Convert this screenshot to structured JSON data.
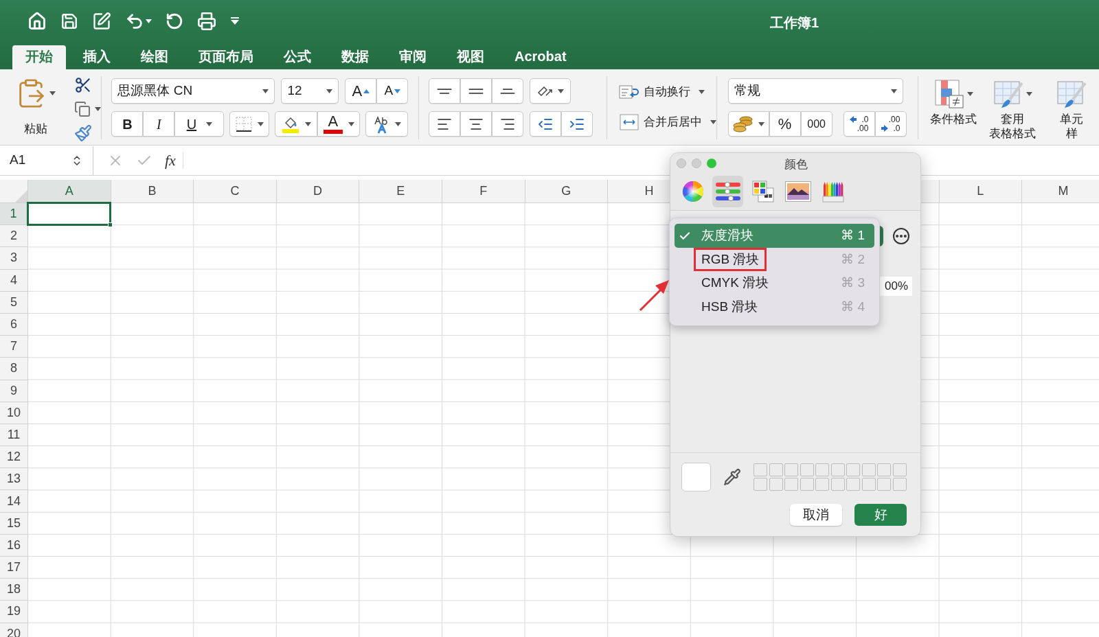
{
  "window": {
    "title": "工作簿1"
  },
  "tabs": [
    {
      "label": "开始",
      "selected": true
    },
    {
      "label": "插入",
      "selected": false
    },
    {
      "label": "绘图",
      "selected": false
    },
    {
      "label": "页面布局",
      "selected": false
    },
    {
      "label": "公式",
      "selected": false
    },
    {
      "label": "数据",
      "selected": false
    },
    {
      "label": "审阅",
      "selected": false
    },
    {
      "label": "视图",
      "selected": false
    },
    {
      "label": "Acrobat",
      "selected": false
    }
  ],
  "ribbon": {
    "paste_label": "粘贴",
    "font": "思源黑体 CN",
    "size": "12",
    "grow_font": "A",
    "shrink_font": "A",
    "bold": "B",
    "italic": "I",
    "underline": "U",
    "font_color": "A",
    "wrap_text": "自动换行",
    "merge_center": "合并后居中",
    "number_format": "常规",
    "percent": "%",
    "thousands": "000",
    "decimal_more": [
      ".0",
      ".00"
    ],
    "decimal_less": [
      ".00",
      ".0"
    ],
    "styles": [
      {
        "lines": [
          "条件格式"
        ]
      },
      {
        "lines": [
          "套用",
          "表格格式"
        ]
      },
      {
        "lines": [
          "单元",
          "样"
        ]
      }
    ]
  },
  "formula_bar": {
    "name_box": "A1",
    "fx": "fx"
  },
  "sheet": {
    "columns_left": [
      {
        "label": "A",
        "selected": true
      },
      {
        "label": "B",
        "selected": false
      },
      {
        "label": "C",
        "selected": false
      },
      {
        "label": "D",
        "selected": false
      },
      {
        "label": "E",
        "selected": false
      },
      {
        "label": "F",
        "selected": false
      },
      {
        "label": "G",
        "selected": false
      },
      {
        "label": "H",
        "selected": false
      }
    ],
    "columns_right": [
      {
        "label": "L",
        "selected": false
      },
      {
        "label": "M",
        "selected": false
      }
    ],
    "rows": [
      {
        "label": "1",
        "selected": true
      },
      {
        "label": "2",
        "selected": false
      },
      {
        "label": "3",
        "selected": false
      },
      {
        "label": "4",
        "selected": false
      },
      {
        "label": "5",
        "selected": false
      },
      {
        "label": "6",
        "selected": false
      },
      {
        "label": "7",
        "selected": false
      },
      {
        "label": "8",
        "selected": false
      },
      {
        "label": "9",
        "selected": false
      },
      {
        "label": "10",
        "selected": false
      },
      {
        "label": "11",
        "selected": false
      },
      {
        "label": "12",
        "selected": false
      },
      {
        "label": "13",
        "selected": false
      },
      {
        "label": "14",
        "selected": false
      },
      {
        "label": "15",
        "selected": false
      },
      {
        "label": "16",
        "selected": false
      },
      {
        "label": "17",
        "selected": false
      },
      {
        "label": "18",
        "selected": false
      },
      {
        "label": "19",
        "selected": false
      },
      {
        "label": "20",
        "selected": false
      }
    ]
  },
  "color_panel": {
    "title": "颜色",
    "modes": [
      {
        "kind": "wheel",
        "selected": false
      },
      {
        "kind": "sliders",
        "selected": true
      },
      {
        "kind": "palettes",
        "selected": false
      },
      {
        "kind": "image",
        "selected": false
      },
      {
        "kind": "pencils",
        "selected": false
      }
    ],
    "opacity_value": "00%",
    "slider_menu": [
      {
        "label": "灰度滑块",
        "shortcut": "⌘ 1",
        "selected": true,
        "outlined": false
      },
      {
        "label": "RGB 滑块",
        "shortcut": "⌘ 2",
        "selected": false,
        "outlined": true
      },
      {
        "label": "CMYK 滑块",
        "shortcut": "⌘ 3",
        "selected": false,
        "outlined": false
      },
      {
        "label": "HSB 滑块",
        "shortcut": "⌘ 4",
        "selected": false,
        "outlined": false
      }
    ],
    "buttons": [
      {
        "label": "取消",
        "kind": "secondary"
      },
      {
        "label": "好",
        "kind": "primary"
      }
    ]
  }
}
